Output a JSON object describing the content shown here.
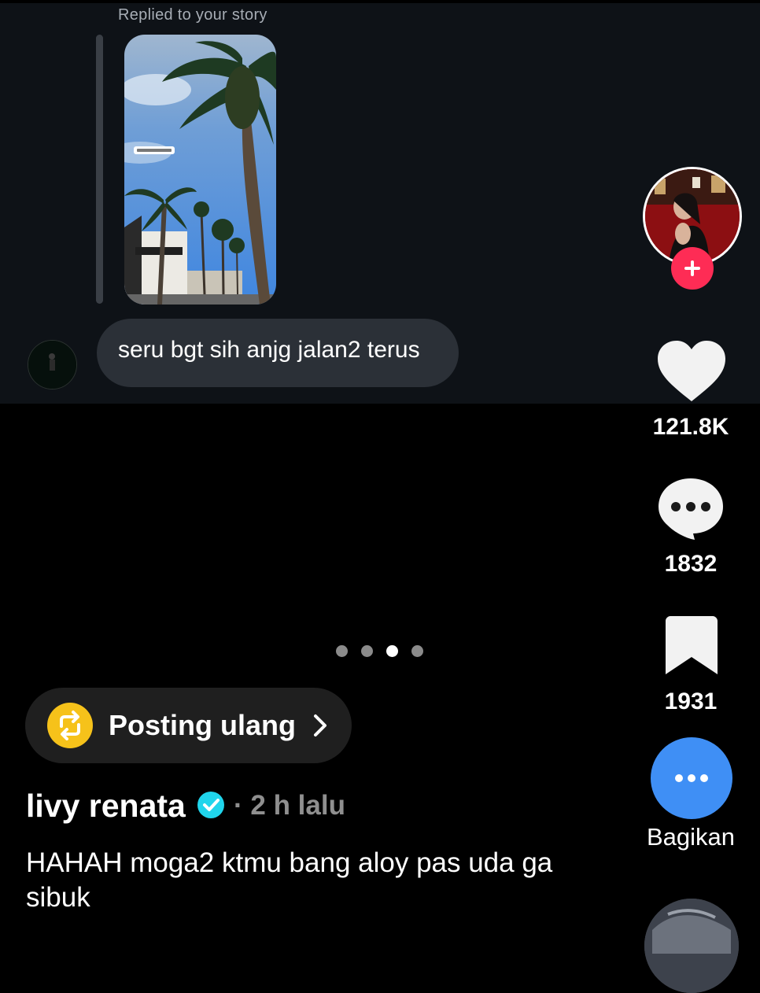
{
  "story_reply": {
    "replied_label": "Replied to your story",
    "message": "seru bgt sih anjg jalan2 terus"
  },
  "actions": {
    "likes": "121.8K",
    "comments": "1832",
    "saves": "1931",
    "share_label": "Bagikan"
  },
  "carousel": {
    "total": 4,
    "active_index": 2
  },
  "repost": {
    "label": "Posting ulang"
  },
  "post": {
    "author": "livy renata",
    "time": "· 2 h lalu",
    "caption": "HAHAH moga2 ktmu bang aloy pas uda ga sibuk"
  },
  "colors": {
    "follow": "#fe2c55",
    "share": "#3f8ff5",
    "repost_icon": "#f6c21a",
    "verified": "#20d5ec"
  },
  "icons": [
    "heart-icon",
    "comment-icon",
    "bookmark-icon",
    "share-more-icon",
    "repost-icon",
    "chevron-right-icon",
    "verified-icon",
    "plus-icon"
  ]
}
